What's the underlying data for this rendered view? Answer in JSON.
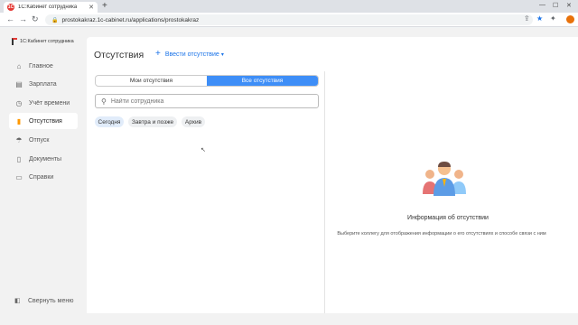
{
  "browser": {
    "tab_title": "1С:Кабинет сотрудника",
    "tab_favicon": "1C",
    "url": "prostokakraz.1c-cabinet.ru/applications/prostokakraz"
  },
  "sidebar": {
    "logo_text": "1С:Кабинет сотрудника",
    "items": [
      {
        "label": "Главное",
        "icon": "home-icon"
      },
      {
        "label": "Зарплата",
        "icon": "wallet-icon"
      },
      {
        "label": "Учёт времени",
        "icon": "clock-icon"
      },
      {
        "label": "Отсутствия",
        "icon": "absences-icon",
        "active": true
      },
      {
        "label": "Отпуск",
        "icon": "vacation-icon"
      },
      {
        "label": "Документы",
        "icon": "document-icon"
      },
      {
        "label": "Справки",
        "icon": "certificate-icon"
      }
    ],
    "collapse_label": "Свернуть меню"
  },
  "main": {
    "title": "Отсутствия",
    "add_label": "Ввести отсутствие",
    "tabs": [
      "Мои отсутствия",
      "Все отсутствия"
    ],
    "active_tab": "Все отсутствия",
    "search_placeholder": "Найти сотрудника",
    "chips": [
      "Сегодня",
      "Завтра и позже",
      "Архив"
    ],
    "selected_chip": "Сегодня"
  },
  "info": {
    "title": "Информация об отсутствии",
    "text": "Выберите коллегу для отображения информации о его отсутствиях и способе связи с ним"
  },
  "colors": {
    "accent": "#3e8ef7",
    "active_icon": "#ff9800",
    "link": "#1a73e8"
  }
}
